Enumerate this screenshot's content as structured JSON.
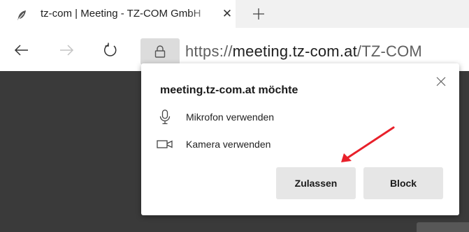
{
  "tab": {
    "title": "tz-com | Meeting - TZ-COM GmbH",
    "favicon": "feather-icon",
    "close_glyph": "✕"
  },
  "toolbar": {
    "back_icon": "arrow-left-icon",
    "forward_icon": "arrow-right-icon",
    "reload_icon": "reload-icon",
    "lock_icon": "lock-icon",
    "url": {
      "protocol": "https://",
      "host": "meeting.tz-com.at",
      "path": "/TZ-COM"
    }
  },
  "popup": {
    "title": "meeting.tz-com.at möchte",
    "permissions": [
      {
        "icon": "microphone-icon",
        "label": "Mikrofon verwenden"
      },
      {
        "icon": "camera-icon",
        "label": "Kamera verwenden"
      }
    ],
    "allow_label": "Zulassen",
    "block_label": "Block"
  },
  "colors": {
    "page_background": "#3a3a3a",
    "button_background": "#e6e6e6",
    "annotation_arrow": "#e8202a"
  }
}
